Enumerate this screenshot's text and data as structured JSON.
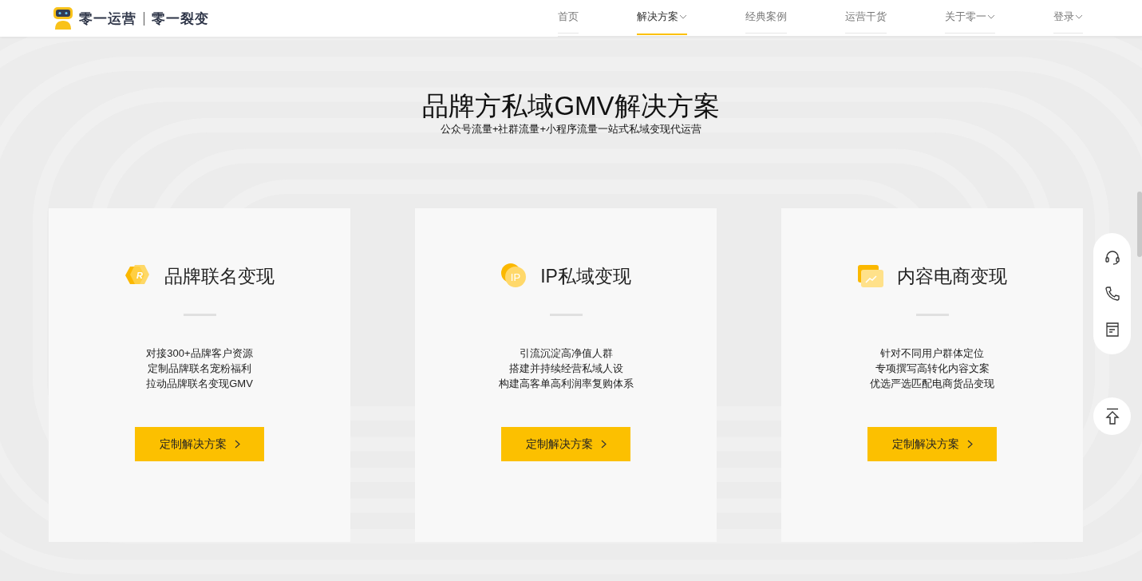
{
  "header": {
    "logo": {
      "brand": "零一运营",
      "sub_brand": "零一裂变"
    },
    "nav": [
      {
        "label": "首页",
        "selected": false,
        "dropdown": false
      },
      {
        "label": "解决方案",
        "selected": true,
        "dropdown": true
      },
      {
        "label": "经典案例",
        "selected": false,
        "dropdown": false
      },
      {
        "label": "运营干货",
        "selected": false,
        "dropdown": false
      },
      {
        "label": "关于零一",
        "selected": false,
        "dropdown": true
      },
      {
        "label": "登录",
        "selected": false,
        "dropdown": true
      }
    ]
  },
  "hero": {
    "title": "品牌方私域GMV解决方案",
    "subtitle": "公众号流量+社群流量+小程序流量一站式私域变现代运营"
  },
  "cards": [
    {
      "kind": "hexagon",
      "badge": "R",
      "title": "品牌联名变现",
      "lines": [
        "对接300+品牌客户资源",
        "定制品牌联名宠粉福利",
        "拉动品牌联名变现GMV"
      ],
      "button": "定制解决方案"
    },
    {
      "kind": "circle",
      "badge": "IP",
      "title": "IP私域变现",
      "lines": [
        "引流沉淀高净值人群",
        "搭建并持续经营私域人设",
        "构建高客单高利润率复购体系"
      ],
      "button": "定制解决方案"
    },
    {
      "kind": "folder",
      "title": "内容电商变现",
      "lines": [
        "针对不同用户群体定位",
        "专项撰写高转化内容文案",
        "优选严选匹配电商货品变现"
      ],
      "button": "定制解决方案"
    }
  ],
  "side_tools": [
    {
      "kind": "headset"
    },
    {
      "kind": "phone"
    },
    {
      "kind": "document"
    }
  ]
}
